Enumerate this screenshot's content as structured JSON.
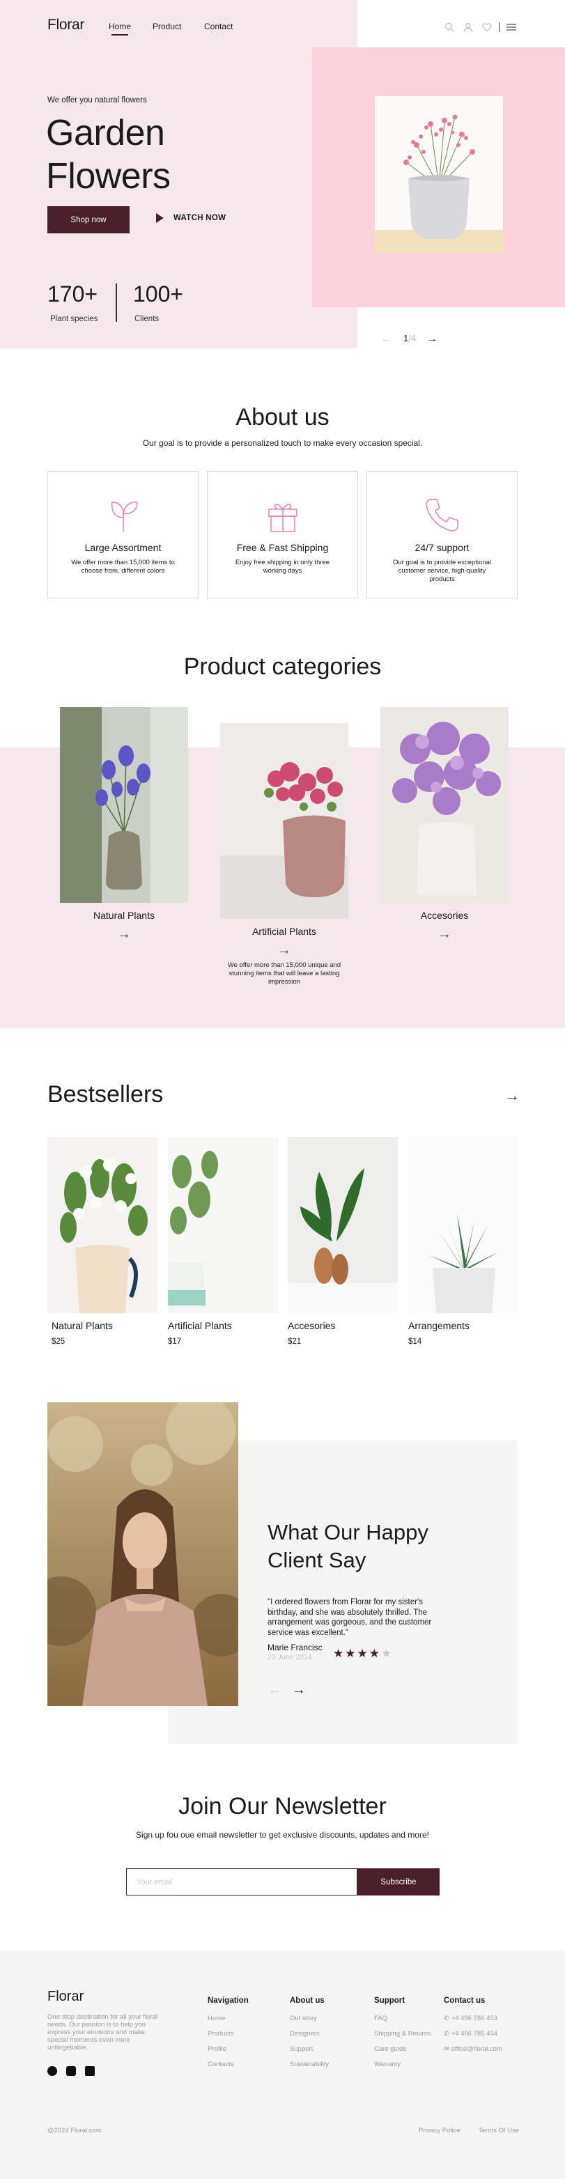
{
  "brand": "Florar",
  "nav": {
    "home": "Home",
    "product": "Product",
    "contact": "Contact"
  },
  "header_icons": [
    "search-icon",
    "user-icon",
    "heart-icon",
    "menu-icon"
  ],
  "hero": {
    "subtitle": "We offer you natural flowers",
    "title": "Garden Flowers",
    "shop_btn": "Shop now",
    "watch_btn": "WATCH NOW",
    "stats": [
      {
        "value": "170+",
        "label": "Plant species"
      },
      {
        "value": "100+",
        "label": "Clients"
      }
    ],
    "slider": {
      "current": "1",
      "total": "/4"
    }
  },
  "about": {
    "title": "About us",
    "subtitle": "Our goal is to provide a personalized touch to make every occasion special.",
    "features": [
      {
        "icon": "leaf-icon",
        "title": "Large Assortment",
        "desc": "We offer more than 15,000 items to choose from, different colors"
      },
      {
        "icon": "gift-icon",
        "title": "Free & Fast Shipping",
        "desc": "Enjoy free shipping in only three working days"
      },
      {
        "icon": "phone-icon",
        "title": "24/7 support",
        "desc": "Our goal is to provide exceptional customer service, high-quality products"
      }
    ]
  },
  "categories": {
    "title": "Product categories",
    "items": [
      {
        "name": "Natural Plants"
      },
      {
        "name": "Artificial Plants",
        "desc": "We offer more than 15,000 unique and stunning items that will leave a lasting impression"
      },
      {
        "name": "Accesories"
      }
    ]
  },
  "bestsellers": {
    "title": "Bestsellers",
    "items": [
      {
        "name": "Natural Plants",
        "price": "$25"
      },
      {
        "name": "Artificial Plants",
        "price": "$17"
      },
      {
        "name": "Accesories",
        "price": "$21"
      },
      {
        "name": "Arrangements",
        "price": "$14"
      }
    ]
  },
  "testimonial": {
    "title": "What Our Happy Client Say",
    "quote": "\"I ordered flowers from Florar for my sister's birthday, and she was absolutely thrilled. The arrangement was gorgeous, and the customer service was excellent.\"",
    "name": "Marie Francisc",
    "date": "20 June 2024",
    "rating": 4,
    "max_rating": 5
  },
  "newsletter": {
    "title": "Join Our Newsletter",
    "subtitle": "Sign up fou oue email newsletter to get exclusive discounts, updates and more!",
    "placeholder": "Your email",
    "button": "Subscribe"
  },
  "footer": {
    "logo": "Florar",
    "desc": "One-stop destination for all your floral needs. Our passion is to help you express your emotions and make special moments even more unforgettable.",
    "social": [
      "facebook-icon",
      "instagram-icon",
      "linkedin-icon"
    ],
    "columns": [
      {
        "title": "Navigation",
        "links": [
          "Home",
          "Products",
          "Profile",
          "Contacts"
        ]
      },
      {
        "title": "About us",
        "links": [
          "Our story",
          "Designers",
          "Support",
          "Sustainability"
        ]
      },
      {
        "title": "Support",
        "links": [
          "FAQ",
          "Shipping & Returns",
          "Care guide",
          "Warranty"
        ]
      },
      {
        "title": "Contact us",
        "links": [
          "+4 456 785 453",
          "+4 456 785 454",
          "office@floral.com"
        ]
      }
    ],
    "copyright": "@2024 Floral.com",
    "privacy": "Privacy Police",
    "terms": "Terms Of Use"
  },
  "colors": {
    "accent": "#4a1f2c",
    "hero_bg": "#f4e8ec",
    "pink_panel": "#f9d2db",
    "icon_pink": "#e9799b"
  }
}
